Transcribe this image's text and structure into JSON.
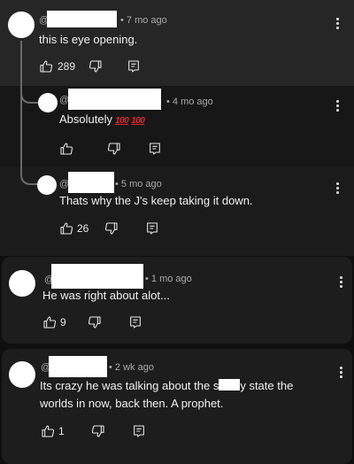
{
  "comments": [
    {
      "handle": "@",
      "time": "• 7 mo ago",
      "text": "this is eye opening.",
      "likes": "289"
    },
    {
      "handle": "@",
      "time": "• 4 mo ago",
      "text": "Absolutely",
      "emoji": [
        "💯",
        "💯"
      ],
      "likes": ""
    },
    {
      "handle": "@",
      "time": "• 5 mo ago",
      "text": "Thats why the J's keep taking it down.",
      "likes": "26"
    },
    {
      "handle": "@",
      "time": "• 1 mo ago",
      "text": "He was right about alot...",
      "likes": "9"
    },
    {
      "handle": "@",
      "time": "• 2 wk ago",
      "text_a": "Its crazy he was talking about the s",
      "text_b": "y state the",
      "text_c": "worlds in now, back then. A prophet.",
      "likes": "1"
    }
  ]
}
